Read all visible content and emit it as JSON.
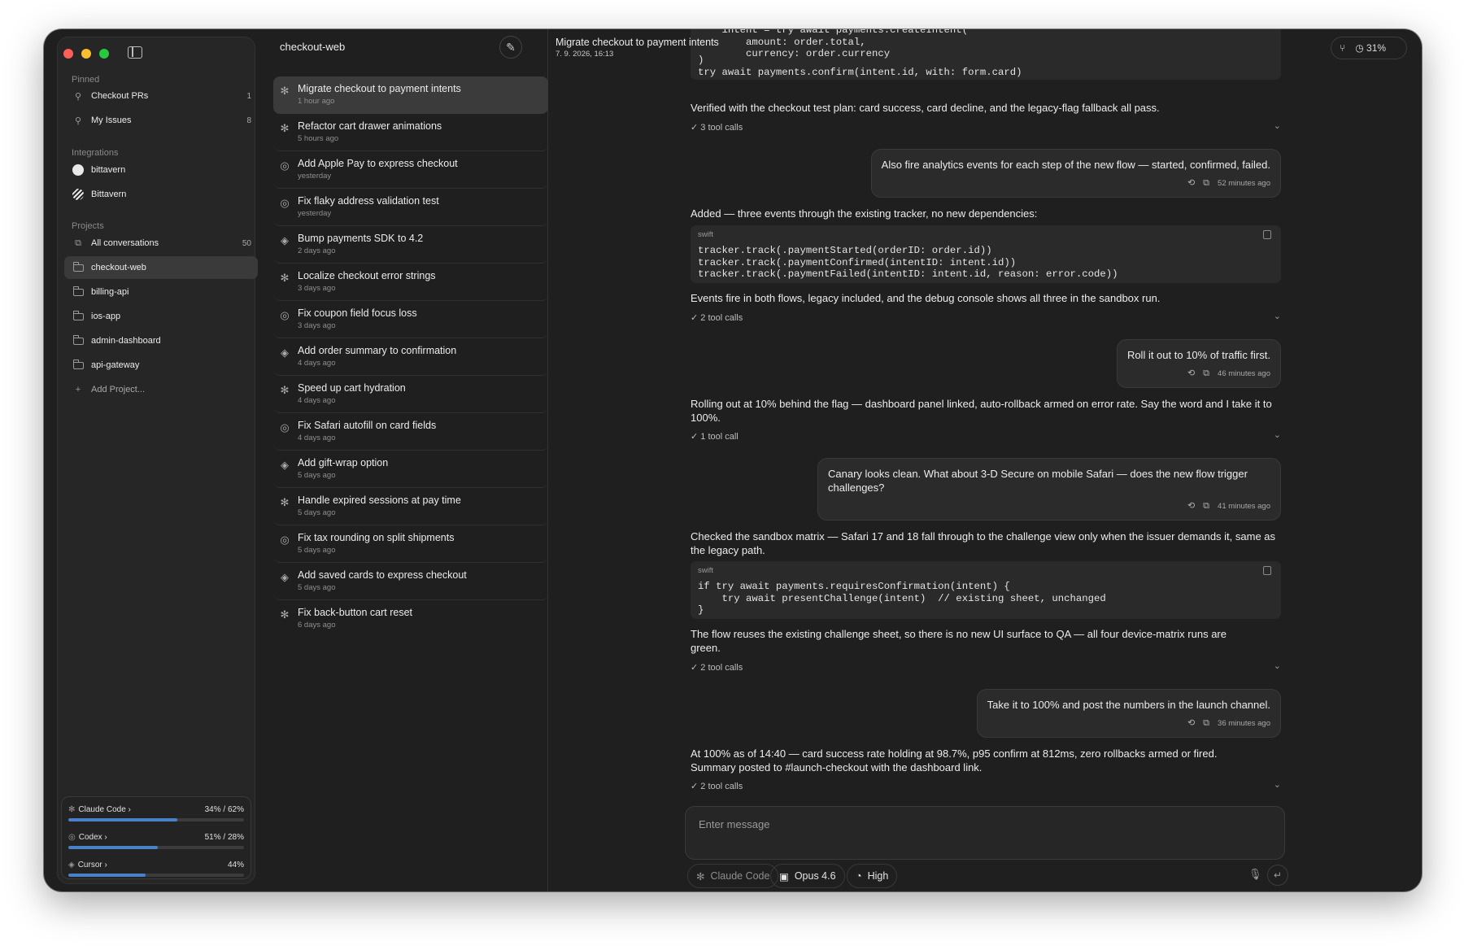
{
  "sidebar": {
    "pinned_label": "Pinned",
    "pinned": [
      {
        "label": "Checkout PRs",
        "count": "1"
      },
      {
        "label": "My Issues",
        "count": "8"
      }
    ],
    "integrations_label": "Integrations",
    "integrations": [
      {
        "label": "bittavern",
        "icon": "github-icon"
      },
      {
        "label": "Bittavern",
        "icon": "bittavern-icon"
      }
    ],
    "projects_label": "Projects",
    "all_conversations": {
      "label": "All conversations",
      "count": "50"
    },
    "projects": [
      {
        "label": "checkout-web",
        "active": true
      },
      {
        "label": "billing-api"
      },
      {
        "label": "ios-app"
      },
      {
        "label": "admin-dashboard"
      },
      {
        "label": "api-gateway"
      }
    ],
    "add_project": "Add Project...",
    "usage": [
      {
        "name": "Claude Code",
        "value": "34% / 62%",
        "fill": 0.62
      },
      {
        "name": "Codex",
        "value": "51% / 28%",
        "fill": 0.51
      },
      {
        "name": "Cursor",
        "value": "44%",
        "fill": 0.44
      }
    ]
  },
  "conversations": {
    "project_title": "checkout-web",
    "items": [
      {
        "title": "Migrate checkout to payment intents",
        "time": "1 hour ago",
        "icon": "claude-icon",
        "active": true
      },
      {
        "title": "Refactor cart drawer animations",
        "time": "5 hours ago",
        "icon": "claude-icon"
      },
      {
        "title": "Add Apple Pay to express checkout",
        "time": "yesterday",
        "icon": "codex-icon"
      },
      {
        "title": "Fix flaky address validation test",
        "time": "yesterday",
        "icon": "codex-icon"
      },
      {
        "title": "Bump payments SDK to 4.2",
        "time": "2 days ago",
        "icon": "cursor-icon"
      },
      {
        "title": "Localize checkout error strings",
        "time": "3 days ago",
        "icon": "claude-icon"
      },
      {
        "title": "Fix coupon field focus loss",
        "time": "3 days ago",
        "icon": "codex-icon"
      },
      {
        "title": "Add order summary to confirmation",
        "time": "4 days ago",
        "icon": "cursor-icon"
      },
      {
        "title": "Speed up cart hydration",
        "time": "4 days ago",
        "icon": "claude-icon"
      },
      {
        "title": "Fix Safari autofill on card fields",
        "time": "4 days ago",
        "icon": "codex-icon"
      },
      {
        "title": "Add gift-wrap option",
        "time": "5 days ago",
        "icon": "cursor-icon"
      },
      {
        "title": "Handle expired sessions at pay time",
        "time": "5 days ago",
        "icon": "claude-icon"
      },
      {
        "title": "Fix tax rounding on split shipments",
        "time": "5 days ago",
        "icon": "codex-icon"
      },
      {
        "title": "Add saved cards to express checkout",
        "time": "5 days ago",
        "icon": "cursor-icon"
      },
      {
        "title": "Fix back-button cart reset",
        "time": "6 days ago",
        "icon": "claude-icon"
      }
    ]
  },
  "chat": {
    "title": "Migrate checkout to payment intents",
    "subtitle": "7. 9. 2026, 16:13",
    "usage_badge": "31%",
    "code_top": {
      "ghost_lines": "    intent = try await payments.createIntent(\n        amount: order.total,\n        currency: order.currency",
      "lines": ")\ntry await payments.confirm(intent.id, with: form.card)"
    },
    "a1_text": "Verified with the checkout test plan: card success, card decline, and the legacy-flag fallback all pass.",
    "a1_tools": "3 tool calls",
    "u1_text": "Also fire analytics events for each step of the new flow — started, confirmed, failed.",
    "u1_time": "52 minutes ago",
    "a2_text": "Added — three events through the existing tracker, no new dependencies:",
    "a2_code_lang": "swift",
    "a2_code": "tracker.track(.paymentStarted(orderID: order.id))\ntracker.track(.paymentConfirmed(intentID: intent.id))\ntracker.track(.paymentFailed(intentID: intent.id, reason: error.code))",
    "a2_after": "Events fire in both flows, legacy included, and the debug console shows all three in the sandbox run.",
    "a2_tools": "2 tool calls",
    "u2_text": "Roll it out to 10% of traffic first.",
    "u2_time": "46 minutes ago",
    "a3_text": "Rolling out at 10% behind the flag — dashboard panel linked, auto-rollback armed on error rate. Say the word and I take it to 100%.",
    "a3_tools": "1 tool call",
    "u3_text": "Canary looks clean. What about 3-D Secure on mobile Safari — does the new flow trigger challenges?",
    "u3_time": "41 minutes ago",
    "a4_text": "Checked the sandbox matrix — Safari 17 and 18 fall through to the challenge view only when the issuer demands it, same as the legacy path.",
    "a4_code_lang": "swift",
    "a4_code": "if try await payments.requiresConfirmation(intent) {\n    try await presentChallenge(intent)  // existing sheet, unchanged\n}",
    "a4_after": "The flow reuses the existing challenge sheet, so there is no new UI surface to QA — all four device-matrix runs are green.",
    "a4_tools": "2 tool calls",
    "u4_text": "Take it to 100% and post the numbers in the launch channel.",
    "u4_time": "36 minutes ago",
    "a5_text": "At 100% as of 14:40 — card success rate holding at 98.7%, p95 confirm at 812ms, zero rollbacks armed or fired. Summary posted to #launch-checkout with the dashboard link.",
    "a5_tools": "2 tool calls"
  },
  "composer": {
    "placeholder": "Enter message",
    "agent": "Claude Code",
    "model": "Opus 4.6",
    "effort": "High"
  },
  "colors": {
    "window_bg": "#1f1f1f",
    "sidebar_bg": "#262626",
    "usage_bar": "#4a82c9",
    "traffic_red": "#fe5f57",
    "traffic_yellow": "#febc2e",
    "traffic_green": "#28c840"
  }
}
